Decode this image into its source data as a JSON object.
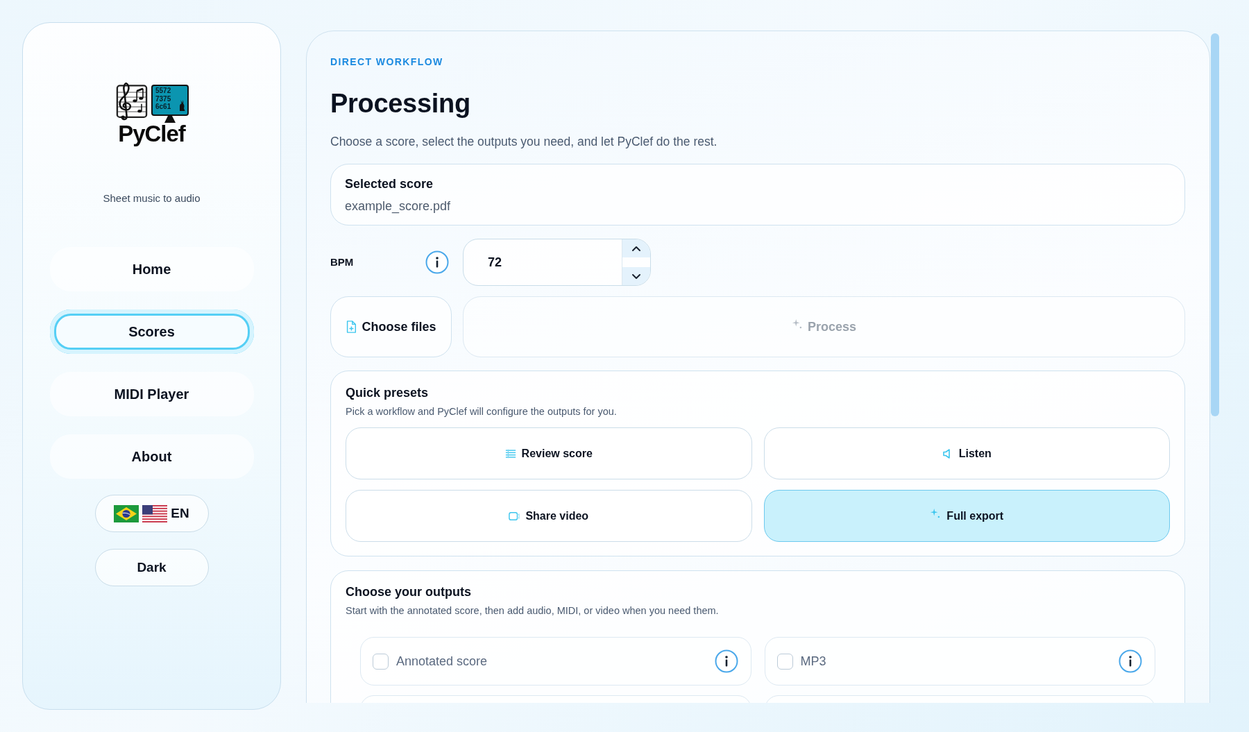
{
  "sidebar": {
    "logo": {
      "screen_lines": [
        "5572",
        "7375",
        "6c61"
      ],
      "wordmark": "PyClef"
    },
    "tagline": "Sheet music to audio",
    "nav": [
      {
        "label": "Home",
        "selected": false
      },
      {
        "label": "Scores",
        "selected": true
      },
      {
        "label": "MIDI Player",
        "selected": false
      },
      {
        "label": "About",
        "selected": false
      }
    ],
    "language_button": {
      "label": "EN"
    },
    "theme_button": {
      "label": "Dark"
    }
  },
  "main": {
    "eyebrow": "DIRECT WORKFLOW",
    "title": "Processing",
    "subtitle": "Choose a score, select the outputs you need, and let PyClef do the rest.",
    "selected_score": {
      "title": "Selected score",
      "file": "example_score.pdf"
    },
    "bpm": {
      "label": "BPM",
      "value": "72"
    },
    "choose_files_button": {
      "label": "Choose files"
    },
    "process_button": {
      "label": "Process",
      "disabled": true
    },
    "quick_presets": {
      "title": "Quick presets",
      "description": "Pick a workflow and PyClef will configure the outputs for you.",
      "presets": [
        {
          "label": "Review score",
          "selected": false
        },
        {
          "label": "Listen",
          "selected": false
        },
        {
          "label": "Share video",
          "selected": false
        },
        {
          "label": "Full export",
          "selected": true
        }
      ]
    },
    "outputs": {
      "title": "Choose your outputs",
      "description": "Start with the annotated score, then add audio, MIDI, or video when you need them.",
      "options": [
        {
          "label": "Annotated score",
          "checked": false
        },
        {
          "label": "MP3",
          "checked": false
        }
      ]
    }
  }
}
